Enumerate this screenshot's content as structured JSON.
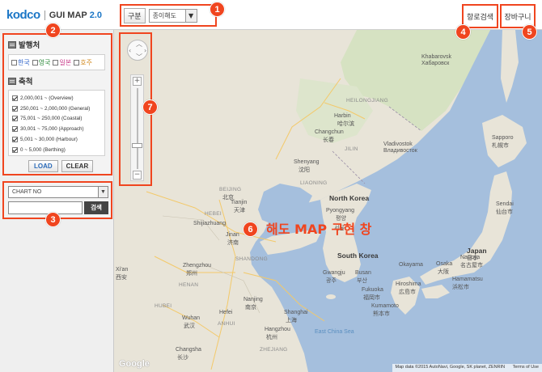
{
  "header": {
    "brand": "kodco",
    "app_name": "GUI MAP",
    "version": "2.0",
    "category_label": "구분",
    "category_select_value": "종이해도",
    "route_search_label": "항로검색",
    "cart_label": "장바구니"
  },
  "badges": [
    "1",
    "2",
    "3",
    "4",
    "5",
    "6",
    "7"
  ],
  "sidebar": {
    "issuer_title": "발행처",
    "issuers": [
      {
        "label": "한국",
        "color": "#2a60c8"
      },
      {
        "label": "영국",
        "color": "#2c8a3a"
      },
      {
        "label": "일본",
        "color": "#c83a8a"
      },
      {
        "label": "호주",
        "color": "#d28a20"
      }
    ],
    "scale_title": "축척",
    "scales": [
      {
        "label": "2,000,001 ~ (Overview)",
        "checked": true
      },
      {
        "label": "250,001 ~ 2,000,000 (General)",
        "checked": true
      },
      {
        "label": "75,001 ~ 250,000 (Coastal)",
        "checked": true
      },
      {
        "label": "30,001 ~ 75,000 (Approach)",
        "checked": true
      },
      {
        "label": "5,001 ~ 30,000 (Harbour)",
        "checked": true
      },
      {
        "label": "0 ~ 5,000 (Berthing)",
        "checked": true
      }
    ],
    "load_label": "LOAD",
    "clear_label": "CLEAR",
    "chart_select_value": "CHART NO",
    "search_label": "검색"
  },
  "map": {
    "overlay_title": "해도 MAP 구현 창",
    "footer_text": "Map data ©2015 AutoNavi, Google, SK planet, ZENRIN",
    "terms": "Terms of Use",
    "google": "Google",
    "labels": {
      "khabarovsk": "Khabarovsk",
      "khabarovsk_ru": "Хабаровск",
      "heilongjiang": "HEILONGJIANG",
      "harbin": "Harbin",
      "harbin_cn": "哈尔滨",
      "changchun": "Changchun",
      "changchun_cn": "长春",
      "jilin": "JILIN",
      "vladivostok": "Vladivostok",
      "vladivostok_ru": "Владивосток",
      "shenyang": "Shenyang",
      "shenyang_cn": "沈阳",
      "liaoning": "LIAONING",
      "beijing": "BEIJING",
      "beijing_cn": "北京",
      "tianjin": "Tianjin",
      "tianjin_cn": "天津",
      "hebei": "HEBEI",
      "shijiazhuang": "Shijiazhuang",
      "jinan": "Jinan",
      "jinan_cn": "济南",
      "shandong": "SHANDONG",
      "north_korea": "North Korea",
      "pyongyang": "Pyongyang",
      "pyongyang_kr": "평양",
      "seoul_kr": "서울",
      "south_korea": "South Korea",
      "gwangju": "Gwangju",
      "gwangju_kr": "광주",
      "busan": "Busan",
      "busan_kr": "부산",
      "sapporo": "Sapporo",
      "sapporo_jp": "札幌市",
      "sendai": "Sendai",
      "sendai_jp": "仙台市",
      "japan": "Japan",
      "japan_jp": "日本",
      "okayama": "Okayama",
      "osaka": "Osaka",
      "osaka_jp": "大阪",
      "nagoya": "Nagoya",
      "nagoya_jp": "名古屋市",
      "hiroshima": "Hiroshima",
      "hiroshima_jp": "広島市",
      "fukuoka": "Fukuoka",
      "fukuoka_jp": "福岡市",
      "hamamatsu": "Hamamatsu",
      "hamamatsu_jp": "浜松市",
      "kumamoto": "Kumamoto",
      "kumamoto_jp": "熊本市",
      "zhengzhou": "Zhengzhou",
      "zhengzhou_cn": "郑州",
      "henan": "HENAN",
      "xian": "Xi'an",
      "xian_cn": "西安",
      "nanjing": "Nanjing",
      "nanjing_cn": "南京",
      "hefei": "Hefei",
      "shanghai": "Shanghai",
      "shanghai_cn": "上海",
      "hubei": "HUBEI",
      "wuhan": "Wuhan",
      "wuhan_cn": "武汉",
      "anhui": "ANHUI",
      "hangzhou": "Hangzhou",
      "hangzhou_cn": "杭州",
      "changsha": "Changsha",
      "changsha_cn": "长沙",
      "zhejiang": "ZHEJIANG",
      "east_china_sea": "East China Sea"
    }
  }
}
